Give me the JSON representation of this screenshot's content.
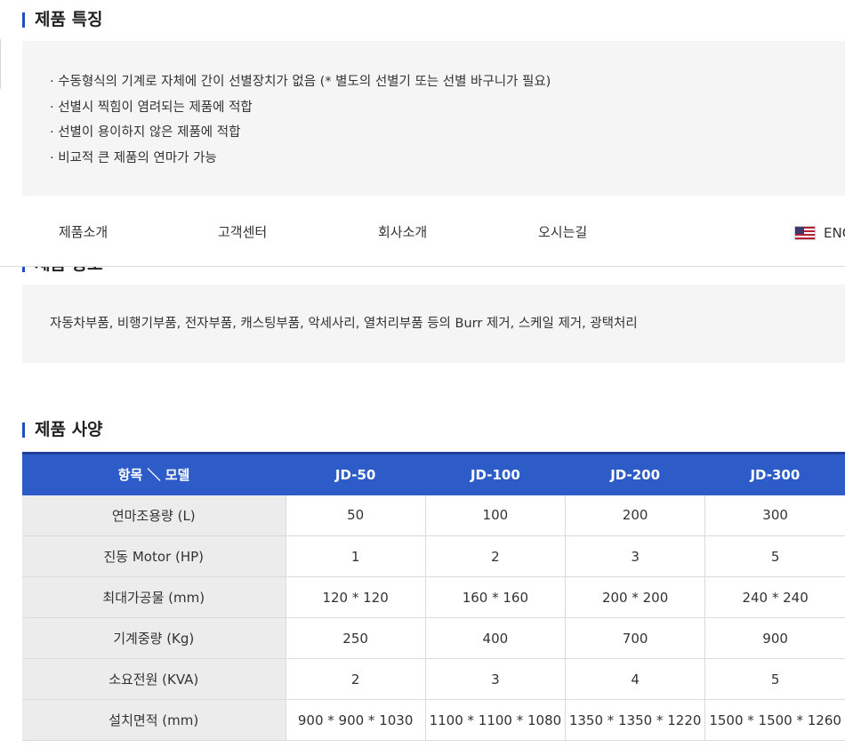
{
  "features": {
    "title": "제품 특징",
    "items": [
      "· 수동형식의 기계로 자체에 간이 선별장치가 없음 (* 별도의 선별기 또는 선별 바구니가 필요)",
      "· 선별시 찍힘이 염려되는 제품에 적합",
      "· 선별이 용이하지 않은 제품에 적합",
      "· 비교적 큰 제품의 연마가 가능"
    ]
  },
  "nav": {
    "items": [
      "제품소개",
      "고객센터",
      "회사소개",
      "오시는길"
    ],
    "lang_label": "ENG",
    "lang_icon": "us-flag-icon"
  },
  "usage": {
    "title": "제품 용도",
    "text": "자동차부품, 비행기부품, 전자부품, 캐스팅부품, 악세사리, 열처리부품 등의 Burr 제거, 스케일 제거, 광택처리"
  },
  "spec": {
    "title": "제품 사양",
    "headers": [
      "항목 ＼ 모델",
      "JD-50",
      "JD-100",
      "JD-200",
      "JD-300"
    ],
    "rows": [
      [
        "연마조용량 (L)",
        "50",
        "100",
        "200",
        "300"
      ],
      [
        "진동 Motor (HP)",
        "1",
        "2",
        "3",
        "5"
      ],
      [
        "최대가공물 (mm)",
        "120 * 120",
        "160 * 160",
        "200 * 200",
        "240 * 240"
      ],
      [
        "기계중량 (Kg)",
        "250",
        "400",
        "700",
        "900"
      ],
      [
        "소요전원 (KVA)",
        "2",
        "3",
        "4",
        "5"
      ],
      [
        "설치면적 (mm)",
        "900 * 900 * 1030",
        "1100 * 1100 * 1080",
        "1350 * 1350 * 1220",
        "1500 * 1500 * 1260"
      ]
    ]
  },
  "colors": {
    "accent": "#2d5bc8",
    "box_bg": "#f5f5f5",
    "label_bg": "#ececec"
  }
}
